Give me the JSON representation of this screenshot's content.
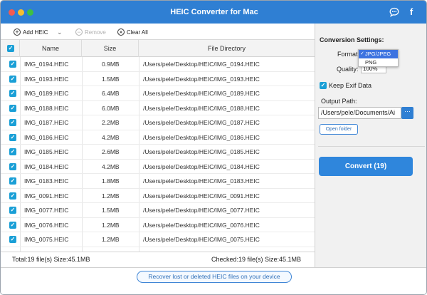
{
  "window": {
    "title": "HEIC Converter for Mac"
  },
  "titlebar": {
    "chat_icon": "chat-bubble-icon",
    "facebook_icon": "facebook-icon",
    "facebook_glyph": "f"
  },
  "toolbar": {
    "add_label": "Add HEIC",
    "add_glyph": "+",
    "dropdown_glyph": "⌄",
    "remove_label": "Remove",
    "remove_glyph": "−",
    "clear_label": "Clear All",
    "clear_glyph": "×"
  },
  "table": {
    "columns": [
      "Name",
      "Size",
      "File Directory"
    ],
    "check_glyph": "✓",
    "rows": [
      {
        "name": "IMG_0194.HEIC",
        "size": "0.9MB",
        "dir": "/Users/pele/Desktop/HEIC/IMG_0194.HEIC"
      },
      {
        "name": "IMG_0193.HEIC",
        "size": "1.5MB",
        "dir": "/Users/pele/Desktop/HEIC/IMG_0193.HEIC"
      },
      {
        "name": "IMG_0189.HEIC",
        "size": "6.4MB",
        "dir": "/Users/pele/Desktop/HEIC/IMG_0189.HEIC"
      },
      {
        "name": "IMG_0188.HEIC",
        "size": "6.0MB",
        "dir": "/Users/pele/Desktop/HEIC/IMG_0188.HEIC"
      },
      {
        "name": "IMG_0187.HEIC",
        "size": "2.2MB",
        "dir": "/Users/pele/Desktop/HEIC/IMG_0187.HEIC"
      },
      {
        "name": "IMG_0186.HEIC",
        "size": "4.2MB",
        "dir": "/Users/pele/Desktop/HEIC/IMG_0186.HEIC"
      },
      {
        "name": "IMG_0185.HEIC",
        "size": "2.6MB",
        "dir": "/Users/pele/Desktop/HEIC/IMG_0185.HEIC"
      },
      {
        "name": "IMG_0184.HEIC",
        "size": "4.2MB",
        "dir": "/Users/pele/Desktop/HEIC/IMG_0184.HEIC"
      },
      {
        "name": "IMG_0183.HEIC",
        "size": "1.8MB",
        "dir": "/Users/pele/Desktop/HEIC/IMG_0183.HEIC"
      },
      {
        "name": "IMG_0091.HEIC",
        "size": "1.2MB",
        "dir": "/Users/pele/Desktop/HEIC/IMG_0091.HEIC"
      },
      {
        "name": "IMG_0077.HEIC",
        "size": "1.5MB",
        "dir": "/Users/pele/Desktop/HEIC/IMG_0077.HEIC"
      },
      {
        "name": "IMG_0076.HEIC",
        "size": "1.2MB",
        "dir": "/Users/pele/Desktop/HEIC/IMG_0076.HEIC"
      },
      {
        "name": "IMG_0075.HEIC",
        "size": "1.2MB",
        "dir": "/Users/pele/Desktop/HEIC/IMG_0075.HEIC"
      }
    ]
  },
  "status": {
    "total": "Total:19 file(s) Size:45.1MB",
    "checked": "Checked:19 file(s) Size:45.1MB"
  },
  "settings": {
    "heading": "Conversion Settings:",
    "format_label": "Format:",
    "format_options": [
      "JPG/JPEG",
      "PNG"
    ],
    "format_selected": "JPG/JPEG",
    "quality_label": "Quality:",
    "quality_value": "100%",
    "stepper_glyph": "⌃⌄",
    "keep_exif_label": "Keep Exif Data",
    "keep_exif_checked": true,
    "output_label": "Output Path:",
    "output_value": "/Users/pele/Documents/Ai",
    "browse_glyph": "···",
    "open_folder_label": "Open folder",
    "convert_label": "Convert (19)"
  },
  "footer": {
    "recover_label": "Recover lost or deleted HEIC files on your device"
  },
  "colors": {
    "accent": "#2f7fd3",
    "checkbox": "#1a9fd6",
    "dropdown_selected": "#3d73e0"
  }
}
